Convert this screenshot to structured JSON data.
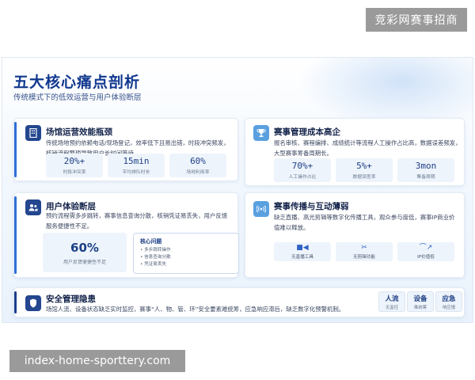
{
  "top_badge": "竞彩网赛事招商",
  "bottom_badge": "index-home-sporttery.com",
  "slide": {
    "title": "五大核心痛点剖析",
    "subtitle": "传统模式下的低效运营与用户体验断层"
  },
  "cards": {
    "venue": {
      "title": "场馆运营效能瓶颈",
      "desc_lines": [
        "传统场地预约依赖电话/现场登记，效率低下且易出错，时段冲突频发，",
        "核销流程繁琐导致用户长时间等待。"
      ],
      "stats": [
        {
          "value": "20%+",
          "label": "时段冲突率"
        },
        {
          "value": "15min",
          "label": "平均排队时长"
        },
        {
          "value": "60%",
          "label": "场地利用率"
        }
      ]
    },
    "cost": {
      "title": "赛事管理成本高企",
      "desc_lines": [
        "报名审核、赛程编排、成绩统计等流程人工操作占比高，数据误差频发，",
        "大型赛事筹备周期长。"
      ],
      "stats": [
        {
          "value": "70%+",
          "label": "人工操作占比"
        },
        {
          "value": "5%+",
          "label": "数据误差率"
        },
        {
          "value": "3mon",
          "label": "筹备周期"
        }
      ]
    },
    "ux": {
      "title": "用户体验断层",
      "desc_lines": [
        "预约流程需多步跳转，赛事信息查询分散，核销凭证易丢失，用户反馈",
        "服务便捷性不足。"
      ],
      "big_stat": {
        "value": "60%",
        "label": "用户反馈便捷性不足"
      },
      "issues_title": "核心问题",
      "issues": [
        "• 多步跳转操作",
        "• 信息查询分散",
        "• 凭证易丢失"
      ]
    },
    "broadcast": {
      "title": "赛事传播与互动薄弱",
      "desc_lines": [
        "缺乏直播、高光剪辑等数字化传播工具，观众参与度低，赛事IP商业价",
        "值难以释放。"
      ],
      "tools": [
        {
          "icon": "■◀",
          "label": "无直播工具"
        },
        {
          "icon": "✂",
          "label": "无剪辑功能"
        },
        {
          "icon": "⌒↗",
          "label": "IP价值低"
        }
      ]
    },
    "security": {
      "title": "安全管理隐患",
      "desc": "场馆人流、设备状态缺乏实时监控，赛事“人、物、管、环”安全要素难统筹，应急响应滞后，缺乏数字化预警机制。",
      "tags": [
        {
          "value": "人流",
          "label": "无监控"
        },
        {
          "value": "设备",
          "label": "难统筹"
        },
        {
          "value": "应急",
          "label": "响应慢"
        }
      ]
    }
  },
  "icons": {
    "venue": "building-icon",
    "cost": "trophy-icon",
    "ux": "users-icon",
    "broadcast": "broadcast-icon",
    "security": "shield-icon"
  },
  "colors": {
    "title": "#10388f",
    "accent": "#2f6fd6",
    "dark_accent": "#1d3f8e",
    "badge_bg": "#9a9a9a"
  }
}
